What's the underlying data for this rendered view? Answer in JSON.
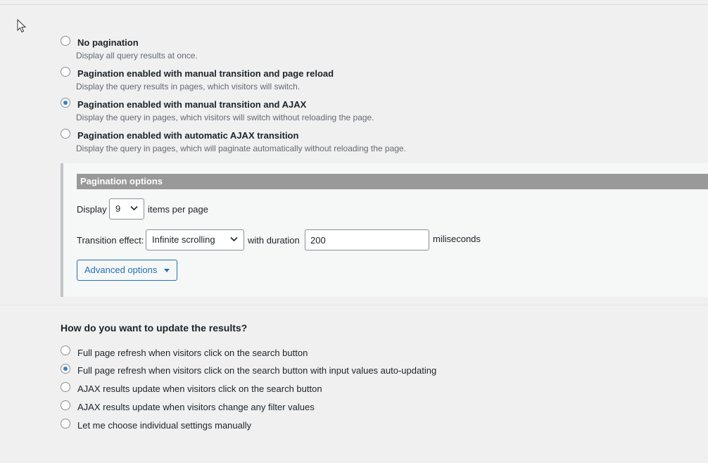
{
  "pagination": {
    "options": [
      {
        "label": "No pagination",
        "desc": "Display all query results at once.",
        "checked": false
      },
      {
        "label": "Pagination enabled with manual transition and page reload",
        "desc": "Display the query results in pages, which visitors will switch.",
        "checked": false
      },
      {
        "label": "Pagination enabled with manual transition and AJAX",
        "desc": "Display the query in pages, which visitors will switch without reloading the page.",
        "checked": true
      },
      {
        "label": "Pagination enabled with automatic AJAX transition",
        "desc": "Display the query in pages, which will paginate automatically without reloading the page.",
        "checked": false
      }
    ]
  },
  "panel": {
    "title": "Pagination options",
    "display_label": "Display",
    "per_page_value": "9",
    "per_page_suffix": "items per page",
    "transition_label": "Transition effect:",
    "transition_value": "Infinite scrolling",
    "duration_label": "with duration",
    "duration_value": "200",
    "duration_unit": "miliseconds",
    "advanced_label": "Advanced options"
  },
  "update": {
    "question": "How do you want to update the results?",
    "options": [
      {
        "label": "Full page refresh when visitors click on the search button",
        "checked": false
      },
      {
        "label": "Full page refresh when visitors click on the search button with input values auto-updating",
        "checked": true
      },
      {
        "label": "AJAX results update when visitors click on the search button",
        "checked": false
      },
      {
        "label": "AJAX results update when visitors change any filter values",
        "checked": false
      },
      {
        "label": "Let me choose individual settings manually",
        "checked": false
      }
    ]
  },
  "icons": {
    "cursor": "mouse-pointer-icon",
    "select_arrow": "chevron-down-icon",
    "advanced_caret": "caret-down-icon"
  },
  "colors": {
    "accent": "#2271b1",
    "radio_checked": "#3582c4",
    "panel_header": "#999999"
  }
}
